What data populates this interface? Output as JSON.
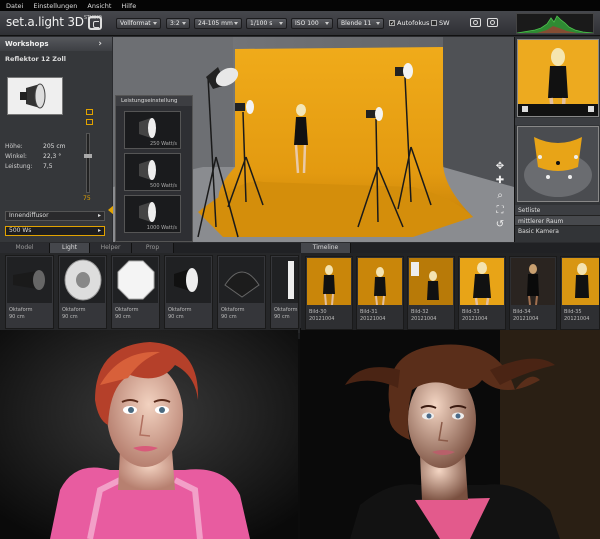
{
  "menu": [
    "Datei",
    "Einstellungen",
    "Ansicht",
    "Hilfe"
  ],
  "app": {
    "logo": "set.a.light 3D",
    "logo_suffix": "STUDIO",
    "toolbar": {
      "format": "Vollformat",
      "ratio": "3:2",
      "lens": "24-105 mm",
      "shutter": "1/100 s",
      "iso": "ISO 100",
      "aperture": "Blende 11",
      "autofocus": "Autofokus",
      "bw": "SW"
    }
  },
  "left_panel": {
    "title": "Workshops",
    "item_name": "Reflektor 12 Zoll",
    "props": [
      {
        "label": "Höhe:",
        "value": "205 cm"
      },
      {
        "label": "Winkel:",
        "value": "22,3 °"
      },
      {
        "label": "Leistung:",
        "value": "7,5"
      }
    ],
    "slider_value": "75",
    "diffusor": "Innendiffusor",
    "power": "500 Ws"
  },
  "power_popup": {
    "title": "Leistungseinstellung",
    "options": [
      "250 Watt/s",
      "500 Watt/s",
      "1000 Watt/s"
    ]
  },
  "right_panel": {
    "setlist_title": "Setliste",
    "setlist_items": [
      "mittlerer Raum",
      "Basic Kamera"
    ]
  },
  "tabs": [
    "Model",
    "Light",
    "Helper",
    "Prop"
  ],
  "active_tab": "Light",
  "timeline_tab": "Timeline",
  "library": [
    {
      "name": "Oktaform",
      "size": "90 cm"
    },
    {
      "name": "Oktaform",
      "size": "90 cm"
    },
    {
      "name": "Oktaform",
      "size": "90 cm"
    },
    {
      "name": "Oktaform",
      "size": "90 cm"
    },
    {
      "name": "Oktaform",
      "size": "90 cm"
    },
    {
      "name": "Oktaform",
      "size": "90 cm"
    }
  ],
  "timeline": [
    {
      "name": "Bild-30",
      "date": "20121004"
    },
    {
      "name": "Bild-31",
      "date": "20121004"
    },
    {
      "name": "Bild-32",
      "date": "20121004"
    },
    {
      "name": "Bild-33",
      "date": "20121004"
    },
    {
      "name": "Bild-34",
      "date": "20121004"
    },
    {
      "name": "Bild-35",
      "date": "20121004"
    }
  ],
  "colors": {
    "accent": "#e2a300",
    "backdrop": "#e8a417",
    "panel": "#35373a"
  }
}
